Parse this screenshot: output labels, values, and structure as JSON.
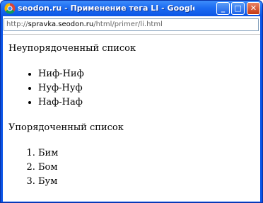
{
  "window": {
    "title": "seodon.ru - Применение тега LI - Google ...",
    "controls": {
      "minimize": "_",
      "maximize": "□",
      "close": "✕"
    }
  },
  "address_bar": {
    "scheme": "http://",
    "host": "spravka.seodon.ru",
    "path": "/html/primer/li.html"
  },
  "page": {
    "unordered_heading": "Неупорядоченный список",
    "unordered_items": [
      "Ниф-Ниф",
      "Нуф-Нуф",
      "Наф-Наф"
    ],
    "ordered_heading": "Упорядоченный список",
    "ordered_items": [
      "Бим",
      "Бом",
      "Бум"
    ]
  },
  "colors": {
    "titlebar": "#0b55e5",
    "close_button": "#c53a15"
  }
}
